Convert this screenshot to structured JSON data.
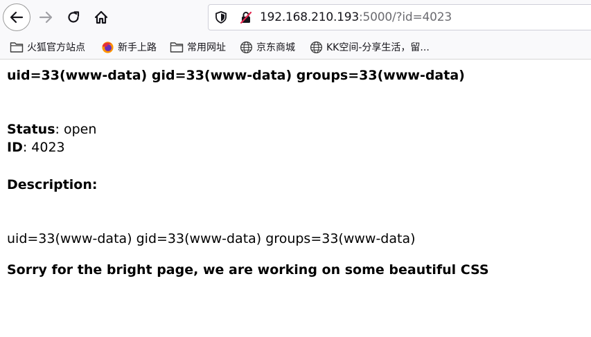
{
  "browser": {
    "url_host": "192.168.210.193",
    "url_rest": ":5000/?id=4023",
    "bookmarks": [
      {
        "label": "火狐官方站点",
        "icon": "folder-icon"
      },
      {
        "label": "新手上路",
        "icon": "firefox-icon"
      },
      {
        "label": "常用网址",
        "icon": "folder-icon"
      },
      {
        "label": "京东商城",
        "icon": "globe-icon"
      },
      {
        "label": "KK空间-分享生活，留...",
        "icon": "globe-icon"
      }
    ]
  },
  "page": {
    "uid_heading": "uid=33(www-data) gid=33(www-data) groups=33(www-data)",
    "status_label": "Status",
    "status_value": ": open",
    "id_label": "ID",
    "id_value": ": 4023",
    "description_label": "Description:",
    "description_text": "uid=33(www-data) gid=33(www-data) groups=33(www-data)",
    "footer_note": "Sorry for the bright page, we are working on some beautiful CSS"
  }
}
